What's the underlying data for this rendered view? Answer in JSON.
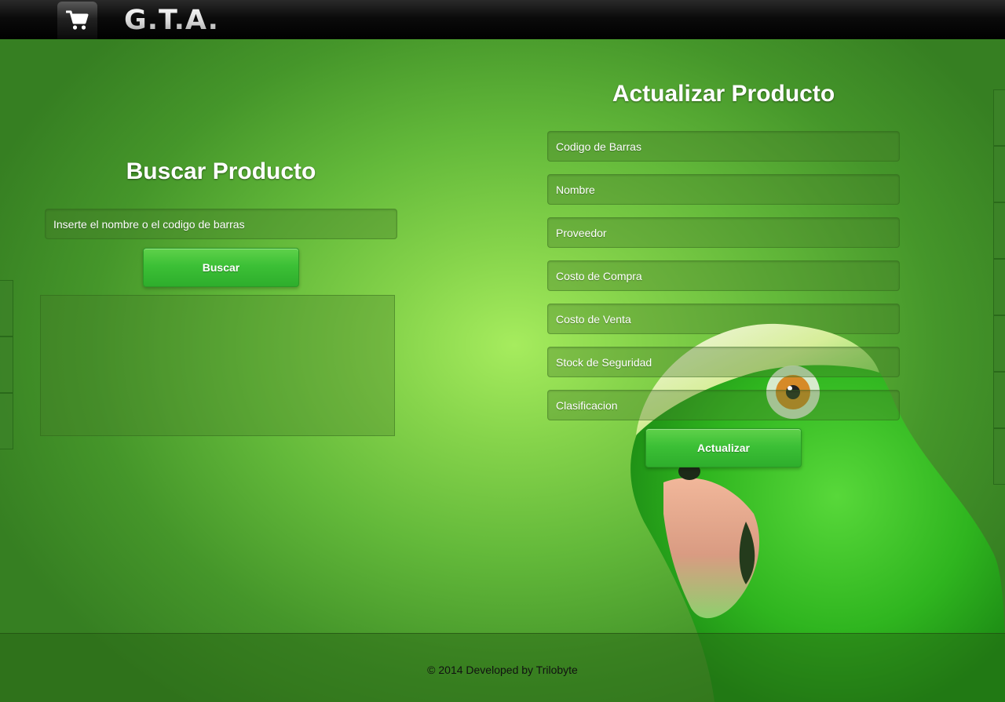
{
  "header": {
    "brand": "G.T.A.",
    "cart_icon": "shopping-cart-icon"
  },
  "search": {
    "title": "Buscar Producto",
    "input_value": "Inserte el nombre o el codigo de barras",
    "button_label": "Buscar"
  },
  "update": {
    "title": "Actualizar Producto",
    "fields": [
      "Codigo de Barras",
      "Nombre",
      "Proveedor",
      "Costo de Compra",
      "Costo de Venta",
      "Stock de Seguridad",
      "Clasificacion"
    ],
    "button_label": "Actualizar"
  },
  "footer": {
    "text": "© 2014 Developed by Trilobyte"
  },
  "colors": {
    "background_green": "#63b93a",
    "button_green": "#3cc036",
    "topbar": "#000000"
  }
}
